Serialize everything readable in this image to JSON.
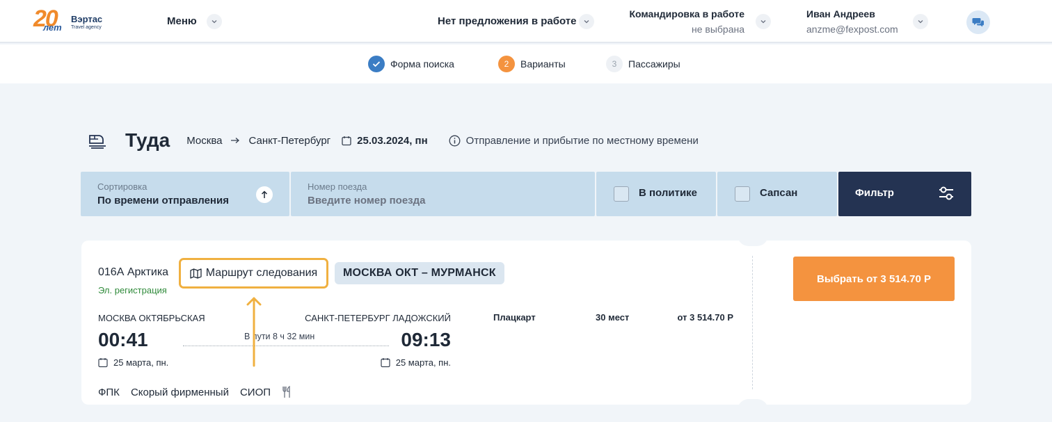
{
  "header": {
    "logo": {
      "number": "20",
      "years": "лет",
      "name": "Вэртас",
      "sub": "Travel agency"
    },
    "menu_label": "Меню",
    "offer_label": "Нет предложения в работе",
    "trip_label": "Командировка в работе",
    "trip_value": "не выбрана",
    "user_name": "Иван Андреев",
    "user_email": "anzme@fexpost.com"
  },
  "steps": [
    {
      "num": "",
      "label": "Форма поиска",
      "state": "done"
    },
    {
      "num": "2",
      "label": "Варианты",
      "state": "active"
    },
    {
      "num": "3",
      "label": "Пассажиры",
      "state": "pending"
    }
  ],
  "direction": {
    "title": "Туда",
    "from": "Москва",
    "to": "Санкт-Петербург",
    "date": "25.03.2024, пн",
    "note": "Отправление и прибытие по местному времени"
  },
  "filters": {
    "sort_label": "Сортировка",
    "sort_value": "По времени отправления",
    "train_label": "Номер поезда",
    "train_placeholder": "Введите номер поезда",
    "policy_label": "В политике",
    "sapsan_label": "Сапсан",
    "filter_label": "Фильтр"
  },
  "result": {
    "train_number": "016А Арктика",
    "registration": "Эл. регистрация",
    "route_button": "Маршрут следования",
    "destination": "МОСКВА ОКТ – МУРМАНСК",
    "from_station": "МОСКВА ОКТЯБРЬСКАЯ",
    "to_station": "САНКТ-ПЕТЕРБУРГ ЛАДОЖСКИЙ",
    "dep_time": "00:41",
    "arr_time": "09:13",
    "duration": "В пути 8 ч 32 мин",
    "dep_date": "25 марта, пн.",
    "arr_date": "25 марта, пн.",
    "carrier": "ФПК",
    "train_type": "Скорый фирменный",
    "service": "СИОП",
    "car_class": "Плацкарт",
    "seats": "30 мест",
    "price": "от 3 514.70 Р",
    "choose_button": "Выбрать от 3 514.70 Р"
  },
  "colors": {
    "accent_orange": "#f4933f",
    "step_done": "#3b7dc4",
    "navy": "#243352",
    "filter_bg": "#c6dcec",
    "highlight": "#f0b040",
    "green": "#2f8a3a"
  }
}
